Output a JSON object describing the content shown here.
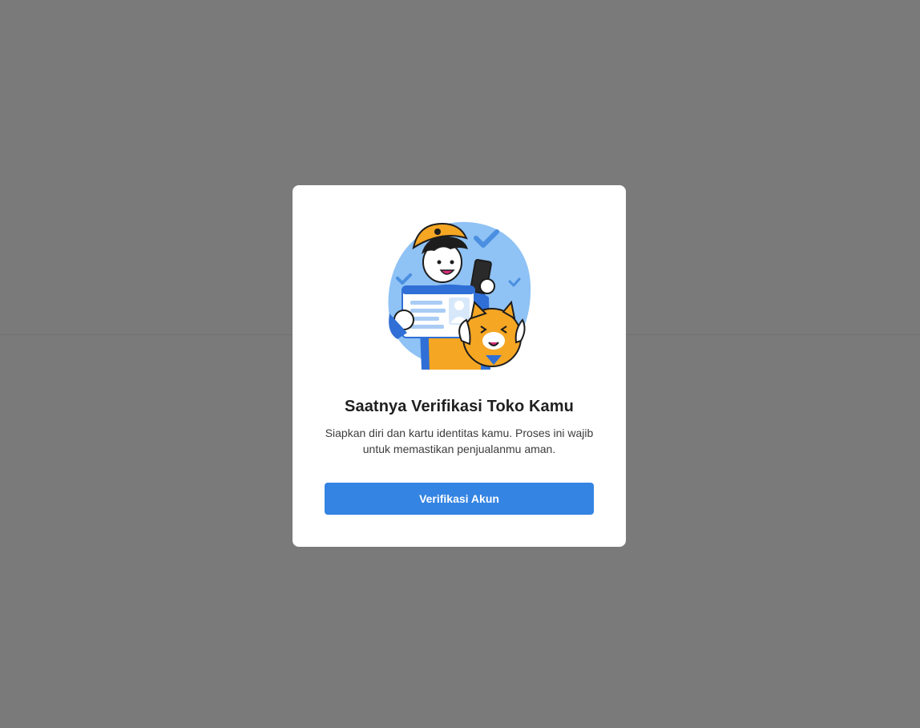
{
  "modal": {
    "title": "Saatnya Verifikasi Toko Kamu",
    "description": "Siapkan diri dan kartu identitas kamu. Proses ini wajib untuk memastikan penjualanmu aman.",
    "button_label": "Verifikasi Akun",
    "illustration": "person-holding-id-card-and-phone-with-cat-illustration"
  },
  "colors": {
    "overlay": "#7a7a7a",
    "modal_bg": "#ffffff",
    "primary": "#3484e3",
    "title_text": "#1f1f1f",
    "body_text": "#3c3c3c",
    "illustration_blob": "#8fc2f5",
    "mascot_orange": "#f5a623"
  }
}
